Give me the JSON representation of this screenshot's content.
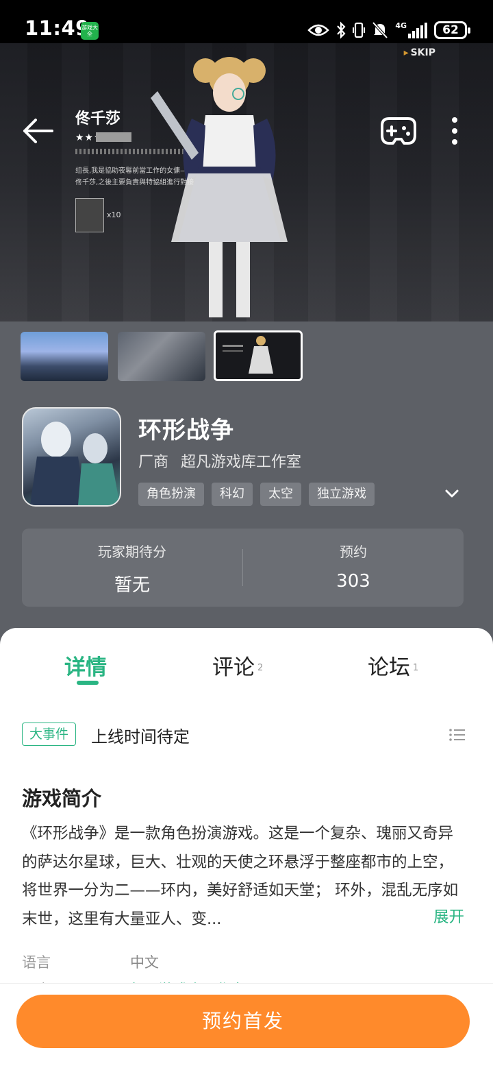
{
  "status_bar": {
    "time": "11:49",
    "app_badge": "游戏大全",
    "network": "4G",
    "battery": "62"
  },
  "hero": {
    "skip_label": "SKIP",
    "character_name": "佟千莎",
    "character_stars": "★★★",
    "character_desc": "组長,我是協助夜鬈前當工作的女傭——佟千莎,之後主要負責與特協組進行對接",
    "item_count": "x10"
  },
  "thumbnails": [
    {
      "name": "screenshot-city"
    },
    {
      "name": "screenshot-group"
    },
    {
      "name": "screenshot-character",
      "selected": true
    }
  ],
  "game": {
    "title": "环形战争",
    "vendor_label": "厂商",
    "vendor_name": "超凡游戏库工作室",
    "tags": [
      "角色扮演",
      "科幻",
      "太空",
      "独立游戏"
    ]
  },
  "stats": {
    "expect_label": "玩家期待分",
    "expect_value": "暂无",
    "reserve_label": "预约",
    "reserve_value": "303"
  },
  "tabs": [
    {
      "label": "详情",
      "count": ""
    },
    {
      "label": "评论",
      "count": "2"
    },
    {
      "label": "论坛",
      "count": "1"
    }
  ],
  "event": {
    "tag": "大事件",
    "text": "上线时间待定"
  },
  "intro": {
    "title": "游戏简介",
    "text": "《环形战争》是一款角色扮演游戏。这是一个复杂、瑰丽又奇异的萨达尔星球，巨大、壮观的天使之环悬浮于整座都市的上空，将世界一分为二——环内，美好舒适如天堂； 环外，混乱无序如末世，这里有大量亚人、变...",
    "expand_label": "展开"
  },
  "info": {
    "language_label": "语言",
    "language_value": "中文",
    "vendor_label": "厂商",
    "vendor_value": "超凡游戏库工作室"
  },
  "bottom": {
    "reserve_button": "预约首发"
  },
  "colors": {
    "accent": "#2ab583",
    "reserve_button": "#ff8a2b",
    "header_bg": "#5d6066"
  }
}
